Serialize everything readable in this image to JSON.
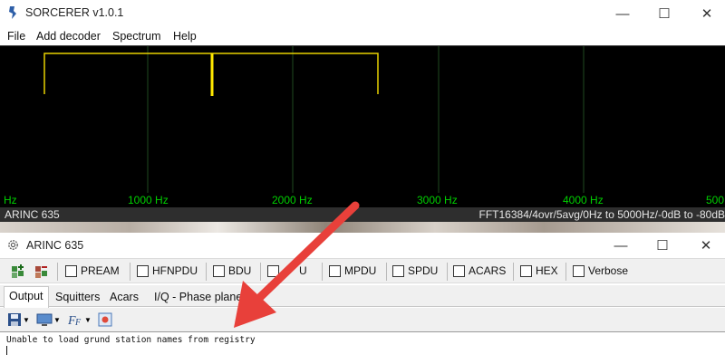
{
  "window": {
    "title": "SORCERER v1.0.1",
    "controls": {
      "minimize": "—",
      "maximize": "☐",
      "close": "✕"
    }
  },
  "menu": [
    "File",
    "Add decoder",
    "Spectrum",
    "Help"
  ],
  "spectrum": {
    "freq_labels": [
      "Hz",
      "1000 Hz",
      "2000 Hz",
      "3000 Hz",
      "4000 Hz",
      "500"
    ],
    "status_left": "ARINC 635",
    "status_right": "FFT16384/4ovr/5avg/0Hz to 5000Hz/-0dB to -80dB",
    "colors": {
      "background": "#000000",
      "trace": "#e8d100",
      "peak": "#ffe800",
      "grid": "#1f4a1f",
      "labels": "#00d000"
    }
  },
  "decoder_window": {
    "title": "ARINC 635",
    "controls": {
      "minimize": "—",
      "maximize": "☐",
      "close": "✕"
    },
    "toolbar": {
      "icons": [
        "add-decoder-icon",
        "remove-decoder-icon"
      ],
      "checkboxes": [
        "PREAM",
        "HFNPDU",
        "BDU",
        "U",
        "MPDU",
        "SPDU",
        "ACARS",
        "HEX",
        "Verbose"
      ]
    },
    "tabs": [
      "Output",
      "Squitters",
      "Acars",
      "I/Q - Phase plane"
    ],
    "active_tab": "Output",
    "output_toolbar_icons": [
      "save-icon",
      "monitor-icon",
      "font-icon",
      "clear-icon"
    ],
    "output_text": "Unable to load grund station names from registry"
  },
  "annotation": {
    "arrow_color": "#e8403a"
  }
}
